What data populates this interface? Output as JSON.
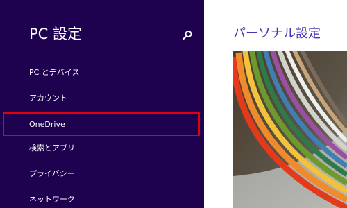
{
  "colors": {
    "sidebar_bg": "#1e0250",
    "content_bg": "#ffffff",
    "accent_text": "#4b2fb4",
    "selection_border": "#e0000e"
  },
  "sidebar": {
    "title": "PC 設定",
    "search_icon": "search-icon",
    "items": [
      {
        "label": "PC とデバイス",
        "selected": false
      },
      {
        "label": "アカウント",
        "selected": false
      },
      {
        "label": "OneDrive",
        "selected": true
      },
      {
        "label": "検索とアプリ",
        "selected": false
      },
      {
        "label": "プライバシー",
        "selected": false
      },
      {
        "label": "ネットワーク",
        "selected": false
      }
    ]
  },
  "content": {
    "title": "パーソナル設定"
  }
}
